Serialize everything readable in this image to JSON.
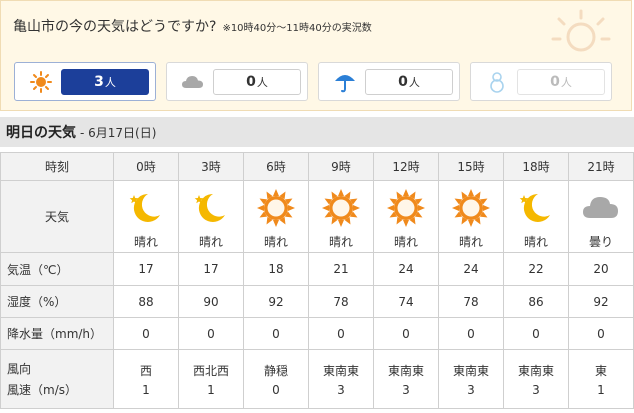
{
  "poll": {
    "title": "亀山市の今の天気はどうですか?",
    "note": "※10時40分～11時40分の実況数",
    "options": [
      {
        "icon": "sun-icon",
        "count": "3",
        "unit": "人",
        "selected": true
      },
      {
        "icon": "cloud-icon",
        "count": "0",
        "unit": "人",
        "selected": false
      },
      {
        "icon": "umbrella-icon",
        "count": "0",
        "unit": "人",
        "selected": false
      },
      {
        "icon": "snowman-icon",
        "count": "0",
        "unit": "人",
        "selected": false
      }
    ]
  },
  "tomorrow": {
    "title": "明日の天気",
    "date": "- 6月17日(日)"
  },
  "table": {
    "row_labels": {
      "time": "時刻",
      "weather": "天気",
      "temp": "気温（℃）",
      "humidity": "湿度（%）",
      "precip": "降水量（mm/h）",
      "wind_dir": "風向",
      "wind_speed": "風速（m/s）"
    },
    "columns": [
      {
        "time": "0時",
        "icon": "moon-icon",
        "weather": "晴れ",
        "temp": "17",
        "humidity": "88",
        "precip": "0",
        "wind_dir": "西",
        "wind_speed": "1"
      },
      {
        "time": "3時",
        "icon": "moon-icon",
        "weather": "晴れ",
        "temp": "17",
        "humidity": "90",
        "precip": "0",
        "wind_dir": "西北西",
        "wind_speed": "1"
      },
      {
        "time": "6時",
        "icon": "sun-icon",
        "weather": "晴れ",
        "temp": "18",
        "humidity": "92",
        "precip": "0",
        "wind_dir": "静穏",
        "wind_speed": "0"
      },
      {
        "time": "9時",
        "icon": "sun-icon",
        "weather": "晴れ",
        "temp": "21",
        "humidity": "78",
        "precip": "0",
        "wind_dir": "東南東",
        "wind_speed": "3"
      },
      {
        "time": "12時",
        "icon": "sun-icon",
        "weather": "晴れ",
        "temp": "24",
        "humidity": "74",
        "precip": "0",
        "wind_dir": "東南東",
        "wind_speed": "3"
      },
      {
        "time": "15時",
        "icon": "sun-icon",
        "weather": "晴れ",
        "temp": "24",
        "humidity": "78",
        "precip": "0",
        "wind_dir": "東南東",
        "wind_speed": "3"
      },
      {
        "time": "18時",
        "icon": "moon-icon",
        "weather": "晴れ",
        "temp": "22",
        "humidity": "86",
        "precip": "0",
        "wind_dir": "東南東",
        "wind_speed": "3"
      },
      {
        "time": "21時",
        "icon": "cloud-icon",
        "weather": "曇り",
        "temp": "20",
        "humidity": "92",
        "precip": "0",
        "wind_dir": "東",
        "wind_speed": "1"
      }
    ]
  },
  "colors": {
    "selected_vote": "#1c3f9a",
    "sun_orange": "#f08a1c",
    "moon_yellow": "#f5b800",
    "header_gray": "#e5e5e5",
    "panel_cream": "#fff8e6"
  }
}
